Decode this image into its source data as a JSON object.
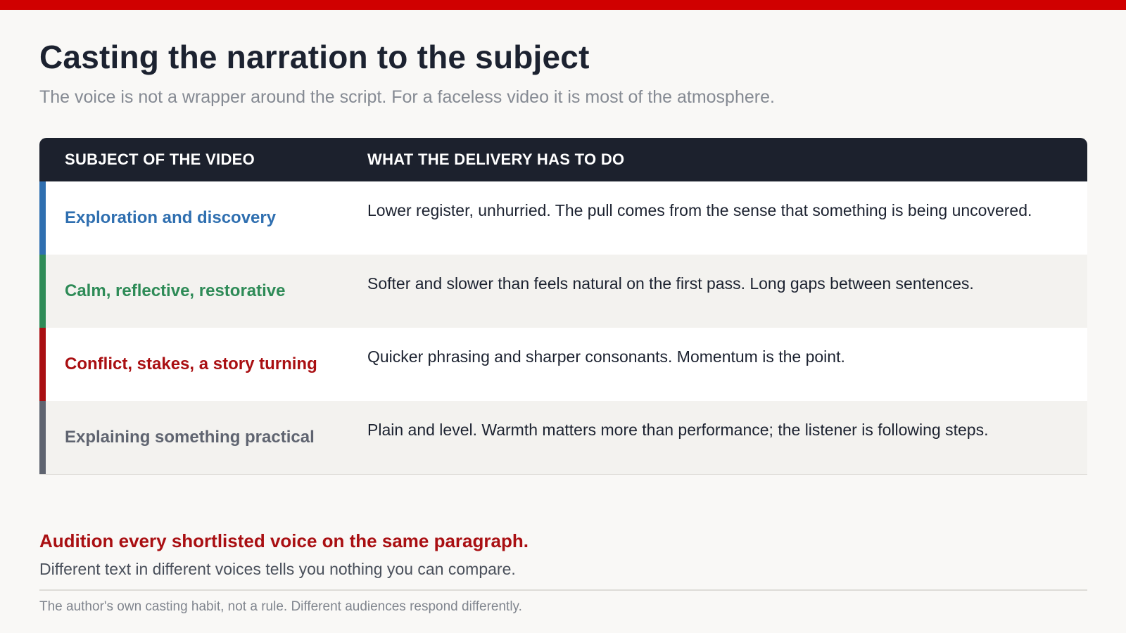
{
  "header": {
    "title": "Casting the narration to the subject",
    "subtitle": "The voice is not a wrapper around the script. For a faceless video it is most of the atmosphere."
  },
  "table": {
    "columns": {
      "subject": "SUBJECT OF THE VIDEO",
      "delivery": "WHAT THE DELIVERY HAS TO DO"
    },
    "rows": [
      {
        "subject": "Exploration and discovery",
        "delivery": "Lower register, unhurried. The pull comes from the sense that something is being uncovered.",
        "accent": "#2f6fb0",
        "background": "#ffffff"
      },
      {
        "subject": "Calm, reflective, restorative",
        "delivery": "Softer and slower than feels natural on the first pass. Long gaps between sentences.",
        "accent": "#2e8b57",
        "background": "#f3f2ef"
      },
      {
        "subject": "Conflict, stakes, a story turning",
        "delivery": "Quicker phrasing and sharper consonants. Momentum is the point.",
        "accent": "#a90f12",
        "background": "#ffffff"
      },
      {
        "subject": "Explaining something practical",
        "delivery": "Plain and level. Warmth matters more than performance; the listener is following steps.",
        "accent": "#5f6470",
        "background": "#f3f2ef"
      }
    ]
  },
  "audition": {
    "heading": "Audition every shortlisted voice on the same paragraph.",
    "text": "Different text in different voices tells you nothing you can compare."
  },
  "footer": {
    "note": "The author's own casting habit, not a rule. Different audiences respond differently."
  },
  "colors": {
    "top_bar": "#d00000",
    "header_bg": "#1c212d",
    "audition_heading": "#a90f12"
  }
}
